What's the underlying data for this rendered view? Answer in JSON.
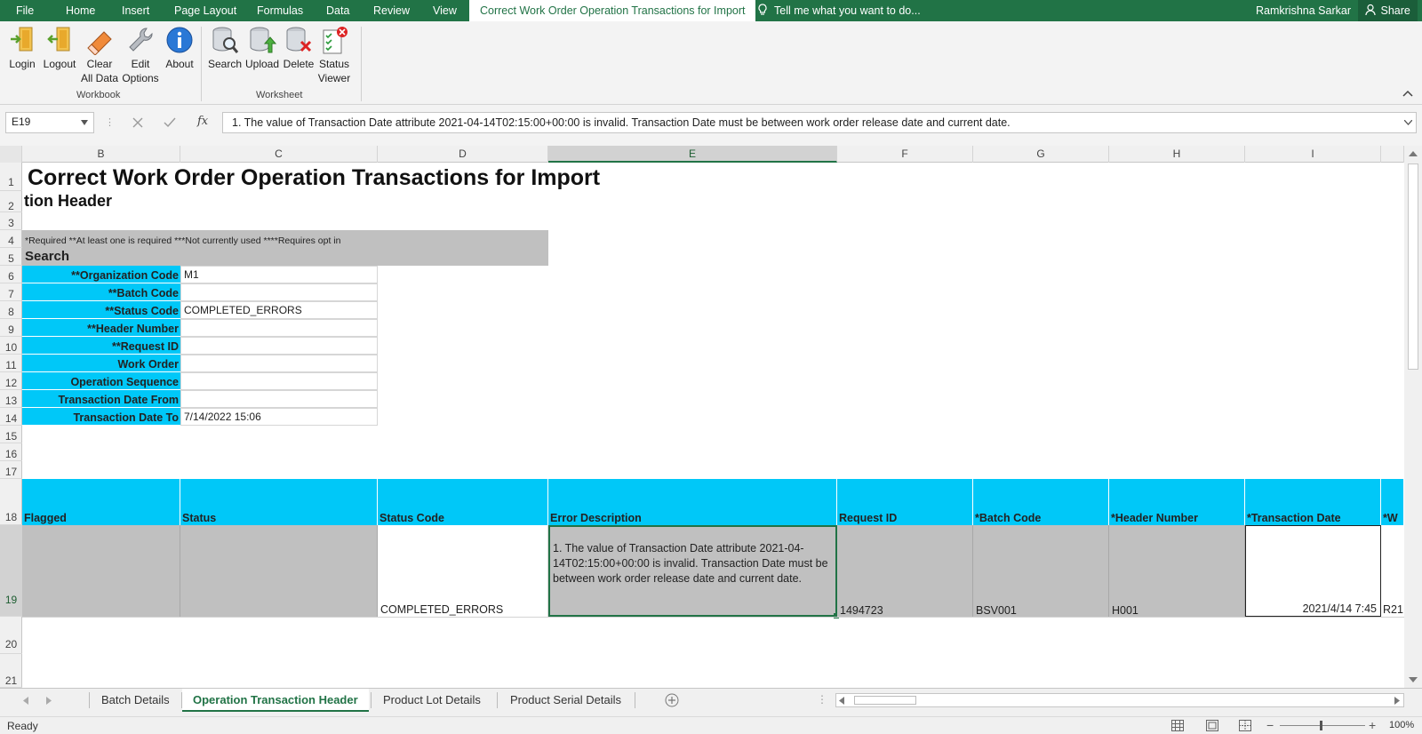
{
  "menu": {
    "file": "File",
    "home": "Home",
    "insert": "Insert",
    "page_layout": "Page Layout",
    "formulas": "Formulas",
    "data": "Data",
    "review": "Review",
    "view": "View",
    "active_tab": "Correct Work Order Operation Transactions for Import",
    "tell_me": "Tell me what you want to do...",
    "user": "Ramkrishna Sarkar",
    "share": "Share"
  },
  "ribbon": {
    "login": "Login",
    "logout": "Logout",
    "clear_1": "Clear",
    "clear_2": "All Data",
    "edit_1": "Edit",
    "edit_2": "Options",
    "about": "About",
    "search": "Search",
    "upload": "Upload",
    "delete": "Delete",
    "status_1": "Status",
    "status_2": "Viewer",
    "group_workbook": "Workbook",
    "group_worksheet": "Worksheet"
  },
  "formula_bar": {
    "name_box": "E19",
    "fx": "fx",
    "content": "1. The value of Transaction Date attribute 2021-04-14T02:15:00+00:00 is invalid. Transaction Date must be between work order release date and current date."
  },
  "columns": [
    "B",
    "C",
    "D",
    "E",
    "F",
    "G",
    "H",
    "I"
  ],
  "rows": [
    "1",
    "2",
    "3",
    "4",
    "5",
    "6",
    "7",
    "8",
    "9",
    "10",
    "11",
    "12",
    "13",
    "14",
    "15",
    "16",
    "17",
    "18",
    "19",
    "20",
    "21"
  ],
  "sheet": {
    "title": "Correct Work Order Operation Transactions for Import",
    "subtitle": "tion Header",
    "legend": "*Required  **At least one is required  ***Not currently used  ****Requires opt in",
    "search_label": "Search",
    "fields": [
      {
        "label": "**Organization Code",
        "value": "M1"
      },
      {
        "label": "**Batch Code",
        "value": ""
      },
      {
        "label": "**Status Code",
        "value": "COMPLETED_ERRORS"
      },
      {
        "label": "**Header Number",
        "value": ""
      },
      {
        "label": "**Request ID",
        "value": ""
      },
      {
        "label": "Work Order",
        "value": ""
      },
      {
        "label": "Operation Sequence",
        "value": ""
      },
      {
        "label": "Transaction Date From",
        "value": ""
      },
      {
        "label": "Transaction Date To",
        "value": "7/14/2022 15:06"
      }
    ],
    "table_headers": [
      "Flagged",
      "Status",
      "Status Code",
      "Error Description",
      "Request ID",
      "*Batch Code",
      "*Header Number",
      "*Transaction Date",
      "*W"
    ],
    "row19": {
      "flagged": "",
      "status": "",
      "status_code": "COMPLETED_ERRORS",
      "error_description": "1. The value of Transaction Date attribute 2021-04-14T02:15:00+00:00 is invalid. Transaction Date must be between work order release date and current date.",
      "request_id": "1494723",
      "batch_code": "BSV001",
      "header_number": "H001",
      "transaction_date": "2021/4/14 7:45",
      "work_order": "R21"
    }
  },
  "tabs": [
    "Batch Details",
    "Operation Transaction Header",
    "Product Lot Details",
    "Product Serial Details"
  ],
  "status_bar": {
    "ready": "Ready",
    "zoom": "100%"
  },
  "colors": {
    "excel_green": "#217346",
    "header_cyan": "#00c8f8",
    "cell_gray": "#c0c0c0"
  }
}
